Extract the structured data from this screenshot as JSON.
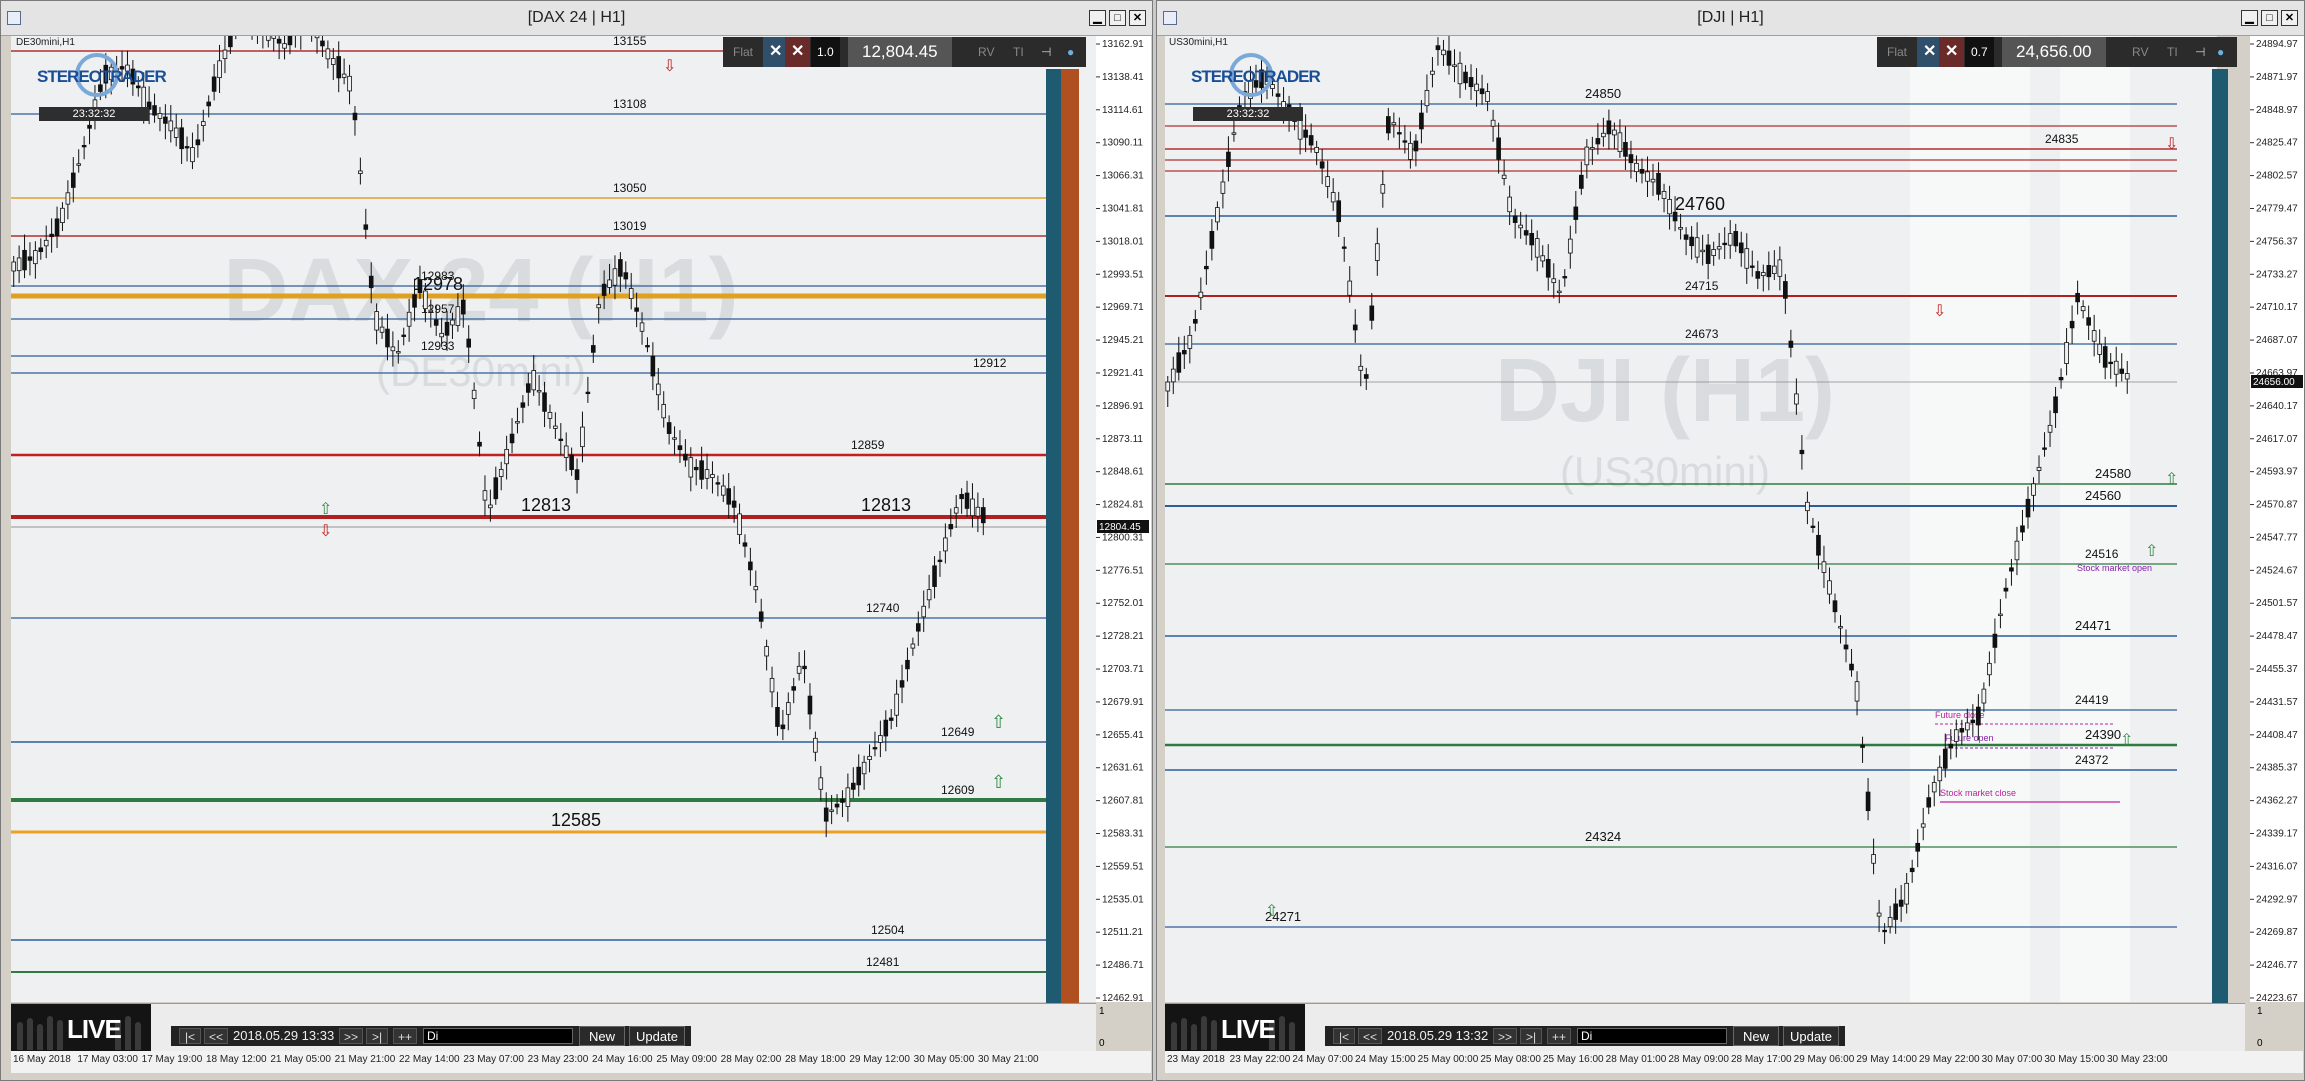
{
  "left": {
    "title": "[DAX 24 | H1]",
    "symbol_label": "DE30mini,H1",
    "logo_text": "STEREOTRADER",
    "clock": "23:32:32",
    "watermark_main": "DAX 24 (H1)",
    "watermark_sub": "(DE30mini)",
    "panel": {
      "flat": "Flat",
      "x1": "✕",
      "x2": "✕",
      "lot": "1.0",
      "price": "12,804.45",
      "rv": "RV",
      "ti": "TI"
    },
    "yaxis_ticks": [
      "13162.91",
      "13138.41",
      "13114.61",
      "13090.11",
      "13066.31",
      "13041.81",
      "13018.01",
      "12993.51",
      "12969.71",
      "12945.21",
      "12921.41",
      "12896.91",
      "12873.11",
      "12848.61",
      "12824.81",
      "12800.31",
      "12776.51",
      "12752.01",
      "12728.21",
      "12703.71",
      "12679.91",
      "12655.41",
      "12631.61",
      "12607.81",
      "12583.31",
      "12559.51",
      "12535.01",
      "12511.21",
      "12486.71",
      "12462.91"
    ],
    "current_price_tag": "12804.45",
    "xaxis_labels": [
      "16 May 2018",
      "17 May 03:00",
      "17 May 19:00",
      "18 May 12:00",
      "21 May 05:00",
      "21 May 21:00",
      "22 May 14:00",
      "23 May 07:00",
      "23 May 23:00",
      "24 May 16:00",
      "25 May 09:00",
      "28 May 02:00",
      "28 May 18:00",
      "29 May 12:00",
      "30 May 05:00",
      "30 May 21:00"
    ],
    "levels": [
      {
        "label": "13155",
        "color": "#b03030"
      },
      {
        "label": "13108",
        "color": "#2e5e9a"
      },
      {
        "label": "13050",
        "color": "#e0a030"
      },
      {
        "label": "13019",
        "color": "#b03030"
      },
      {
        "label": "12983",
        "color": "#2e5e9a"
      },
      {
        "label": "12978",
        "color": "#e0a020"
      },
      {
        "label": "12957",
        "color": "#2e5e9a"
      },
      {
        "label": "12933",
        "color": "#2e5e9a"
      },
      {
        "label": "12912",
        "color": "#2e5e9a"
      },
      {
        "label": "12859",
        "color": "#c02020"
      },
      {
        "label": "12813",
        "color": "#b02020"
      },
      {
        "label": "12813",
        "color": "#b02020"
      },
      {
        "label": "12740",
        "color": "#2e5e9a"
      },
      {
        "label": "12649",
        "color": "#2e5e9a"
      },
      {
        "label": "12609",
        "color": "#2e7a40"
      },
      {
        "label": "12585",
        "color": "#f0a020"
      },
      {
        "label": "12504",
        "color": "#2e5e9a"
      },
      {
        "label": "12481",
        "color": "#2e7a40"
      }
    ],
    "nav": {
      "first": "|<",
      "prev": "<<",
      "date": "2018.05.29 13:33",
      "next": ">>",
      "last": ">|",
      "plus": "++",
      "input": "Di",
      "new": "New",
      "update": "Update"
    },
    "live": "LIVE",
    "right_axis_bottom": [
      "1",
      "0"
    ]
  },
  "right": {
    "title": "[DJI | H1]",
    "symbol_label": "US30mini,H1",
    "logo_text": "STEREOTRADER",
    "clock": "23:32:32",
    "watermark_main": "DJI (H1)",
    "watermark_sub": "(US30mini)",
    "panel": {
      "flat": "Flat",
      "x1": "✕",
      "x2": "✕",
      "lot": "0.7",
      "price": "24,656.00",
      "rv": "RV",
      "ti": "TI"
    },
    "yaxis_ticks": [
      "24894.97",
      "24871.97",
      "24848.97",
      "24825.47",
      "24802.57",
      "24779.47",
      "24756.37",
      "24733.27",
      "24710.17",
      "24687.07",
      "24663.97",
      "24640.17",
      "24617.07",
      "24593.97",
      "24570.87",
      "24547.77",
      "24524.67",
      "24501.57",
      "24478.47",
      "24455.37",
      "24431.57",
      "24408.47",
      "24385.37",
      "24362.27",
      "24339.17",
      "24316.07",
      "24292.97",
      "24269.87",
      "24246.77",
      "24223.67"
    ],
    "current_price_tag": "24656.00",
    "xaxis_labels": [
      "23 May 2018",
      "23 May 22:00",
      "24 May 07:00",
      "24 May 15:00",
      "25 May 00:00",
      "25 May 08:00",
      "25 May 16:00",
      "28 May 01:00",
      "28 May 09:00",
      "28 May 17:00",
      "29 May 06:00",
      "29 May 14:00",
      "29 May 22:00",
      "30 May 07:00",
      "30 May 15:00",
      "30 May 23:00"
    ],
    "levels": [
      {
        "label": "24850",
        "color": "#2e5e9a"
      },
      {
        "label": "24835",
        "color": "#b03030"
      },
      {
        "label": "24760",
        "color": "#2e5e9a"
      },
      {
        "label": "24715",
        "color": "#b02020"
      },
      {
        "label": "24673",
        "color": "#2e5e9a"
      },
      {
        "label": "24580",
        "color": "#2e7a40"
      },
      {
        "label": "24560",
        "color": "#2e5e9a"
      },
      {
        "label": "24516",
        "color": "#2e7a40"
      },
      {
        "label": "24471",
        "color": "#2e5e9a"
      },
      {
        "label": "24419",
        "color": "#2e5e9a"
      },
      {
        "label": "24390",
        "color": "#2e7a40"
      },
      {
        "label": "24372",
        "color": "#2e5e9a"
      },
      {
        "label": "24324",
        "color": "#2e7a40"
      },
      {
        "label": "24271",
        "color": "#2e5e9a"
      }
    ],
    "annotations": {
      "stock_open": "Stock market open",
      "future_close": "Future close",
      "future_open": "Future open",
      "stock_close": "Stock market close"
    },
    "nav": {
      "first": "|<",
      "prev": "<<",
      "date": "2018.05.29 13:32",
      "next": ">>",
      "last": ">|",
      "plus": "++",
      "input": "Di",
      "new": "New",
      "update": "Update"
    },
    "live": "LIVE",
    "right_axis_bottom": [
      "1",
      "0"
    ]
  }
}
